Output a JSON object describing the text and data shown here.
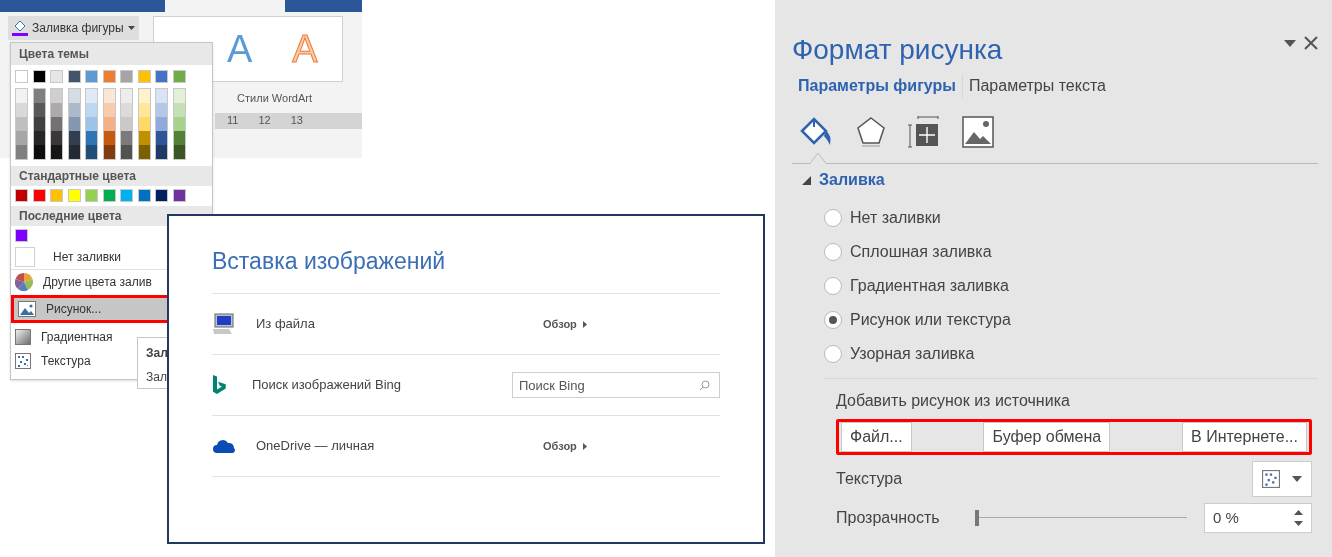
{
  "ribbon": {
    "fill_button": "Заливка фигуры",
    "wordart_letters": [
      {
        "text": "A",
        "kind": "solid"
      },
      {
        "text": "A",
        "kind": "outline"
      }
    ],
    "wordart_label": "Стили WordArt",
    "ruler_marks": [
      "11",
      "12",
      "13"
    ]
  },
  "fill_menu": {
    "theme_header": "Цвета темы",
    "theme_colors": [
      {
        "color": "#ffffff",
        "shades": [
          {
            "color": "#f2f2f2"
          },
          {
            "color": "#d9d9d9"
          },
          {
            "color": "#bfbfbf"
          },
          {
            "color": "#a6a6a6"
          },
          {
            "color": "#808080"
          }
        ]
      },
      {
        "color": "#000000",
        "shades": [
          {
            "color": "#7f7f7f"
          },
          {
            "color": "#595959"
          },
          {
            "color": "#404040"
          },
          {
            "color": "#262626"
          },
          {
            "color": "#0d0d0d"
          }
        ]
      },
      {
        "color": "#e7e6e6",
        "shades": [
          {
            "color": "#d0cece"
          },
          {
            "color": "#aeaaaa"
          },
          {
            "color": "#757171"
          },
          {
            "color": "#3a3838"
          },
          {
            "color": "#171616"
          }
        ]
      },
      {
        "color": "#44546a",
        "shades": [
          {
            "color": "#d6dce4"
          },
          {
            "color": "#adb9ca"
          },
          {
            "color": "#8497b0"
          },
          {
            "color": "#333f4f"
          },
          {
            "color": "#222a35"
          }
        ]
      },
      {
        "color": "#5b9bd5",
        "shades": [
          {
            "color": "#deebf6"
          },
          {
            "color": "#bdd7ee"
          },
          {
            "color": "#9dc3e6"
          },
          {
            "color": "#2e75b5"
          },
          {
            "color": "#1f4e79"
          }
        ]
      },
      {
        "color": "#ed7d31",
        "shades": [
          {
            "color": "#fbe5d5"
          },
          {
            "color": "#f8cbad"
          },
          {
            "color": "#f4b183"
          },
          {
            "color": "#c55a11"
          },
          {
            "color": "#833c0b"
          }
        ]
      },
      {
        "color": "#a5a5a5",
        "shades": [
          {
            "color": "#ededed"
          },
          {
            "color": "#dbdbdb"
          },
          {
            "color": "#c9c9c9"
          },
          {
            "color": "#7b7b7b"
          },
          {
            "color": "#525252"
          }
        ]
      },
      {
        "color": "#ffc000",
        "shades": [
          {
            "color": "#fff2cc"
          },
          {
            "color": "#ffe699"
          },
          {
            "color": "#ffd966"
          },
          {
            "color": "#bf9000"
          },
          {
            "color": "#7f6000"
          }
        ]
      },
      {
        "color": "#4472c4",
        "shades": [
          {
            "color": "#dae3f3"
          },
          {
            "color": "#b4c7e7"
          },
          {
            "color": "#8faadc"
          },
          {
            "color": "#2f5597"
          },
          {
            "color": "#203864"
          }
        ]
      },
      {
        "color": "#70ad47",
        "shades": [
          {
            "color": "#e2f0d9"
          },
          {
            "color": "#c5e0b4"
          },
          {
            "color": "#a9d18e"
          },
          {
            "color": "#538135"
          },
          {
            "color": "#385723"
          }
        ]
      }
    ],
    "standard_header": "Стандартные цвета",
    "standard_colors": [
      {
        "color": "#c00000"
      },
      {
        "color": "#ff0000"
      },
      {
        "color": "#ffc000"
      },
      {
        "color": "#ffff00"
      },
      {
        "color": "#92d050"
      },
      {
        "color": "#00b050"
      },
      {
        "color": "#00b0f0"
      },
      {
        "color": "#0070c0"
      },
      {
        "color": "#002060"
      },
      {
        "color": "#7030a0"
      }
    ],
    "recent_header": "Последние цвета",
    "recent_colors": [
      {
        "color": "#7f00ff"
      }
    ],
    "items": [
      {
        "kind": "none",
        "label": "Нет заливки",
        "highlighted": false
      },
      {
        "kind": "colors",
        "label": "Другие цвета залив",
        "highlighted": false
      },
      {
        "kind": "picture",
        "label": "Рисунок...",
        "highlighted": true
      },
      {
        "kind": "gradient",
        "label": "Градиентная",
        "highlighted": false
      },
      {
        "kind": "texture",
        "label": "Текстура",
        "highlighted": false
      }
    ],
    "submenu": [
      "Зал",
      "Зал"
    ]
  },
  "insert_dialog": {
    "title": "Вставка изображений",
    "rows": [
      {
        "kind": "file",
        "label": "Из файла",
        "action": "Обзор"
      },
      {
        "kind": "bing",
        "label": "Поиск изображений Bing",
        "placeholder": "Поиск Bing"
      },
      {
        "kind": "onedrive",
        "label": "OneDrive — личная",
        "action": "Обзор"
      }
    ]
  },
  "format_pane": {
    "title": "Формат рисунка",
    "tabs": [
      {
        "label": "Параметры фигуры",
        "selected": true
      },
      {
        "label": "Параметры текста",
        "selected": false
      }
    ],
    "section": {
      "title": "Заливка",
      "expanded": true
    },
    "options": [
      {
        "label": "Нет заливки",
        "selected": false
      },
      {
        "label": "Сплошная заливка",
        "selected": false
      },
      {
        "label": "Градиентная заливка",
        "selected": false
      },
      {
        "label": "Рисунок или текстура",
        "selected": true
      },
      {
        "label": "Узорная заливка",
        "selected": false
      }
    ],
    "source_label": "Добавить рисунок из источника",
    "source_buttons": [
      "Файл...",
      "Буфер обмена",
      "В Интернете..."
    ],
    "source_highlighted": true,
    "texture_label": "Текстура",
    "transparency_label": "Прозрачность",
    "transparency": {
      "level": 0
    },
    "transparency_value": "0 %"
  }
}
